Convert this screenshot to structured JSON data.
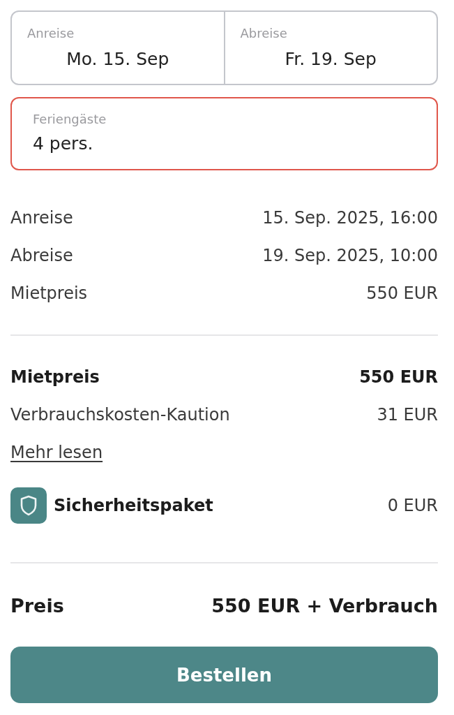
{
  "dates": [
    {
      "label": "Anreise",
      "value": "Mo. 15. Sep"
    },
    {
      "label": "Abreise",
      "value": "Fr. 19. Sep"
    }
  ],
  "guests": {
    "label": "Feriengäste",
    "value": "4 pers.",
    "invalid": true
  },
  "details": [
    {
      "label": "Anreise",
      "value": "15. Sep. 2025, 16:00"
    },
    {
      "label": "Abreise",
      "value": "19. Sep. 2025, 10:00"
    },
    {
      "label": "Mietpreis",
      "value": "550 EUR"
    }
  ],
  "costs": [
    {
      "kind": "bold",
      "label": "Mietpreis",
      "value": "550 EUR"
    },
    {
      "kind": "plain",
      "label": "Verbrauchskosten-Kaution",
      "value": "31 EUR"
    },
    {
      "kind": "link",
      "label": "Mehr lesen"
    },
    {
      "kind": "package",
      "label": "Sicherheitspaket",
      "value": "0 EUR"
    }
  ],
  "total": {
    "label": "Preis",
    "value": "550 EUR + Verbrauch"
  },
  "button": {
    "label": "Bestellen"
  }
}
